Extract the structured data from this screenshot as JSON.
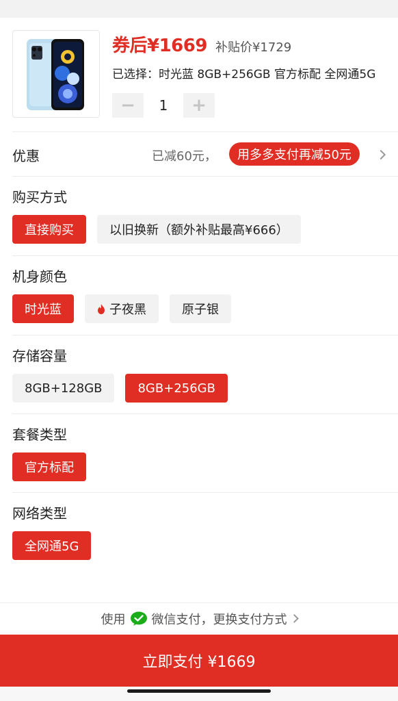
{
  "product": {
    "image_icon": "phone-product-image",
    "price": "券后¥1669",
    "subsidy_price": "补贴价¥1729",
    "selected": "已选择：时光蓝 8GB+256GB 官方标配 全网通5G",
    "quantity": "1",
    "minus_label": "−",
    "plus_label": "+"
  },
  "discount": {
    "label": "优惠",
    "reduced": "已减60元，",
    "extra": "用多多支付再减50元"
  },
  "groups": {
    "purchase": {
      "title": "购买方式",
      "options": [
        "直接购买",
        "以旧换新（额外补贴最高¥666）"
      ],
      "selected": "直接购买"
    },
    "color": {
      "title": "机身颜色",
      "options": [
        "时光蓝",
        "子夜黑",
        "原子银"
      ],
      "selected": "时光蓝",
      "hot_icon": "flame-icon"
    },
    "storage": {
      "title": "存储容量",
      "options": [
        "8GB+128GB",
        "8GB+256GB"
      ],
      "selected": "8GB+256GB"
    },
    "package": {
      "title": "套餐类型",
      "options": [
        "官方标配"
      ],
      "selected": "官方标配"
    },
    "network": {
      "title": "网络类型",
      "options": [
        "全网通5G"
      ],
      "selected": "全网通5G"
    }
  },
  "footer": {
    "use": "使用",
    "wechat_icon": "wechat-icon",
    "method": "微信支付，更换支付方式",
    "pay_button": "立即支付 ¥1669"
  },
  "colors": {
    "accent": "#e02e24",
    "option_bg": "#f2f2f2"
  }
}
